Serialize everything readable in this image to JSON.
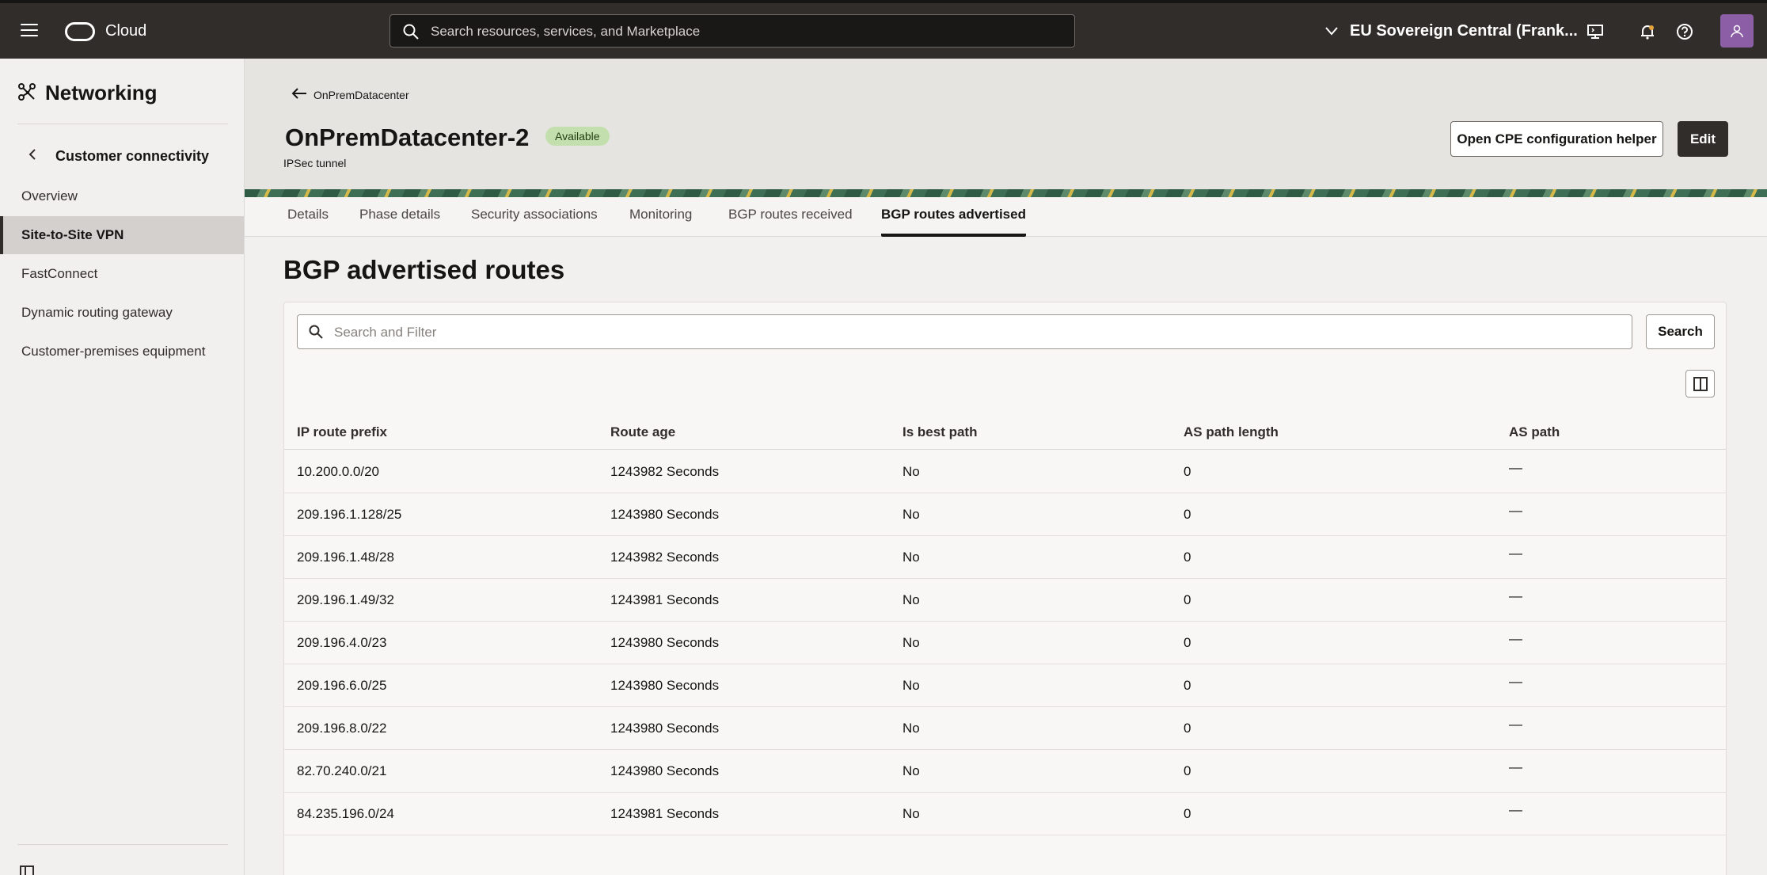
{
  "header": {
    "brand": "Cloud",
    "search_placeholder": "Search resources, services, and Marketplace",
    "region": "EU Sovereign Central (Frank..."
  },
  "sidebar": {
    "title": "Networking",
    "section": "Customer connectivity",
    "items": [
      {
        "label": "Overview",
        "active": false
      },
      {
        "label": "Site-to-Site VPN",
        "active": true
      },
      {
        "label": "FastConnect",
        "active": false
      },
      {
        "label": "Dynamic routing gateway",
        "active": false
      },
      {
        "label": "Customer-premises equipment",
        "active": false
      }
    ]
  },
  "page": {
    "breadcrumb": "OnPremDatacenter",
    "title": "OnPremDatacenter-2",
    "status": "Available",
    "subtitle": "IPSec tunnel",
    "cpe_button": "Open CPE configuration helper",
    "edit_button": "Edit"
  },
  "tabs": [
    {
      "label": "Details",
      "active": false
    },
    {
      "label": "Phase details",
      "active": false
    },
    {
      "label": "Security associations",
      "active": false
    },
    {
      "label": "Monitoring",
      "active": false
    },
    {
      "label": "BGP routes received",
      "active": false
    },
    {
      "label": "BGP routes advertised",
      "active": true
    }
  ],
  "content": {
    "title": "BGP advertised routes",
    "filter_placeholder": "Search and Filter",
    "search_button": "Search"
  },
  "table": {
    "columns": [
      "IP route prefix",
      "Route age",
      "Is best path",
      "AS path length",
      "AS path"
    ],
    "rows": [
      [
        "10.200.0.0/20",
        "1243982 Seconds",
        "No",
        "0",
        "—"
      ],
      [
        "209.196.1.128/25",
        "1243980 Seconds",
        "No",
        "0",
        "—"
      ],
      [
        "209.196.1.48/28",
        "1243982 Seconds",
        "No",
        "0",
        "—"
      ],
      [
        "209.196.1.49/32",
        "1243981 Seconds",
        "No",
        "0",
        "—"
      ],
      [
        "209.196.4.0/23",
        "1243980 Seconds",
        "No",
        "0",
        "—"
      ],
      [
        "209.196.6.0/25",
        "1243980 Seconds",
        "No",
        "0",
        "—"
      ],
      [
        "209.196.8.0/22",
        "1243980 Seconds",
        "No",
        "0",
        "—"
      ],
      [
        "82.70.240.0/21",
        "1243980 Seconds",
        "No",
        "0",
        "—"
      ],
      [
        "84.235.196.0/24",
        "1243981 Seconds",
        "No",
        "0",
        "—"
      ]
    ]
  },
  "colors": {
    "header_bg": "#312d2a",
    "badge_bg": "#c4dfae",
    "primary_button": "#312d2a",
    "avatar": "#8c5ea6"
  }
}
